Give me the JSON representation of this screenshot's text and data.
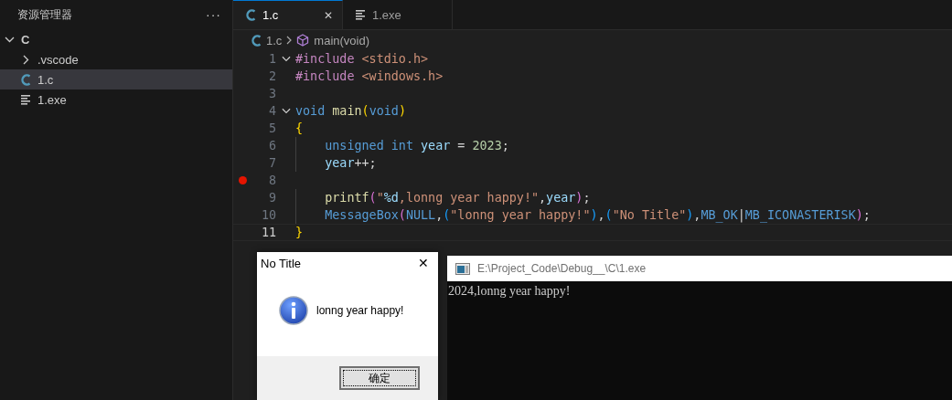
{
  "sidebar": {
    "title": "资源管理器",
    "more": "···",
    "tree": [
      {
        "name": "C",
        "kind": "folder",
        "expanded": true,
        "selected": false,
        "children": [
          {
            "name": ".vscode",
            "kind": "folder",
            "expanded": false,
            "selected": false
          },
          {
            "name": "1.c",
            "kind": "c-file",
            "selected": true
          },
          {
            "name": "1.exe",
            "kind": "text-file",
            "selected": false
          }
        ]
      }
    ]
  },
  "tabs": [
    {
      "label": "1.c",
      "kind": "c-file",
      "selected": true,
      "close": "✕"
    },
    {
      "label": "1.exe",
      "kind": "text-file",
      "selected": false
    }
  ],
  "breadcrumb": {
    "file": "1.c",
    "symbol": "main(void)"
  },
  "code": [
    {
      "number": "1",
      "fold": true,
      "breakpoint": false,
      "current": false,
      "indented": false,
      "tokens": [
        {
          "kind": "preproc",
          "text": "#include "
        },
        {
          "kind": "string",
          "text": "<stdio.h>"
        }
      ]
    },
    {
      "number": "2",
      "fold": false,
      "breakpoint": false,
      "current": false,
      "indented": false,
      "tokens": [
        {
          "kind": "preproc",
          "text": "#include "
        },
        {
          "kind": "string",
          "text": "<windows.h>"
        }
      ]
    },
    {
      "number": "3",
      "fold": false,
      "breakpoint": false,
      "current": false,
      "indented": false
    },
    {
      "number": "4",
      "fold": true,
      "breakpoint": false,
      "current": false,
      "indented": false,
      "tokens": [
        {
          "kind": "keyword",
          "text": "void "
        },
        {
          "kind": "function",
          "text": "main"
        },
        {
          "kind": "bracket1",
          "text": "("
        },
        {
          "kind": "keyword",
          "text": "void"
        },
        {
          "kind": "bracket1",
          "text": ")"
        }
      ]
    },
    {
      "number": "5",
      "fold": false,
      "breakpoint": false,
      "current": false,
      "indented": false,
      "tokens": [
        {
          "kind": "bracket1",
          "text": "{"
        }
      ]
    },
    {
      "number": "6",
      "fold": false,
      "breakpoint": false,
      "current": false,
      "indented": true,
      "tokens": [
        {
          "kind": "keyword",
          "text": "unsigned int "
        },
        {
          "kind": "variable",
          "text": "year"
        },
        {
          "kind": "plain",
          "text": " = "
        },
        {
          "kind": "number",
          "text": "2023"
        },
        {
          "kind": "plain",
          "text": ";"
        }
      ]
    },
    {
      "number": "7",
      "fold": false,
      "breakpoint": false,
      "current": false,
      "indented": true,
      "tokens": [
        {
          "kind": "variable",
          "text": "year"
        },
        {
          "kind": "plain",
          "text": "++;"
        }
      ]
    },
    {
      "number": "8",
      "fold": false,
      "breakpoint": true,
      "current": false,
      "indented": false
    },
    {
      "number": "9",
      "fold": false,
      "breakpoint": false,
      "current": false,
      "indented": true,
      "tokens": [
        {
          "kind": "function",
          "text": "printf"
        },
        {
          "kind": "bracket2",
          "text": "("
        },
        {
          "kind": "string",
          "text": "\""
        },
        {
          "kind": "format",
          "text": "%d"
        },
        {
          "kind": "string",
          "text": ",lonng year happy!\""
        },
        {
          "kind": "plain",
          "text": ","
        },
        {
          "kind": "variable",
          "text": "year"
        },
        {
          "kind": "bracket2",
          "text": ")"
        },
        {
          "kind": "plain",
          "text": ";"
        }
      ]
    },
    {
      "number": "10",
      "fold": false,
      "breakpoint": false,
      "current": false,
      "indented": true,
      "tokens": [
        {
          "kind": "macro",
          "text": "MessageBox"
        },
        {
          "kind": "bracket2",
          "text": "("
        },
        {
          "kind": "macro",
          "text": "NULL"
        },
        {
          "kind": "plain",
          "text": ","
        },
        {
          "kind": "bracket3",
          "text": "("
        },
        {
          "kind": "string",
          "text": "\"lonng year happy!\""
        },
        {
          "kind": "bracket3",
          "text": ")"
        },
        {
          "kind": "plain",
          "text": ","
        },
        {
          "kind": "bracket3",
          "text": "("
        },
        {
          "kind": "string",
          "text": "\"No Title\""
        },
        {
          "kind": "bracket3",
          "text": ")"
        },
        {
          "kind": "plain",
          "text": ","
        },
        {
          "kind": "macro",
          "text": "MB_OK"
        },
        {
          "kind": "plain",
          "text": "|"
        },
        {
          "kind": "macro",
          "text": "MB_ICONASTERISK"
        },
        {
          "kind": "bracket2",
          "text": ")"
        },
        {
          "kind": "plain",
          "text": ";"
        }
      ]
    },
    {
      "number": "11",
      "fold": false,
      "breakpoint": false,
      "current": true,
      "indented": false,
      "tokens": [
        {
          "kind": "bracket1",
          "text": "}"
        }
      ]
    }
  ],
  "dialog": {
    "title": "No Title",
    "close": "✕",
    "message": "lonng year happy!",
    "button": "确定"
  },
  "console": {
    "title": "E:\\Project_Code\\Debug__\\C\\1.exe",
    "output": "2024,lonng year happy!"
  }
}
